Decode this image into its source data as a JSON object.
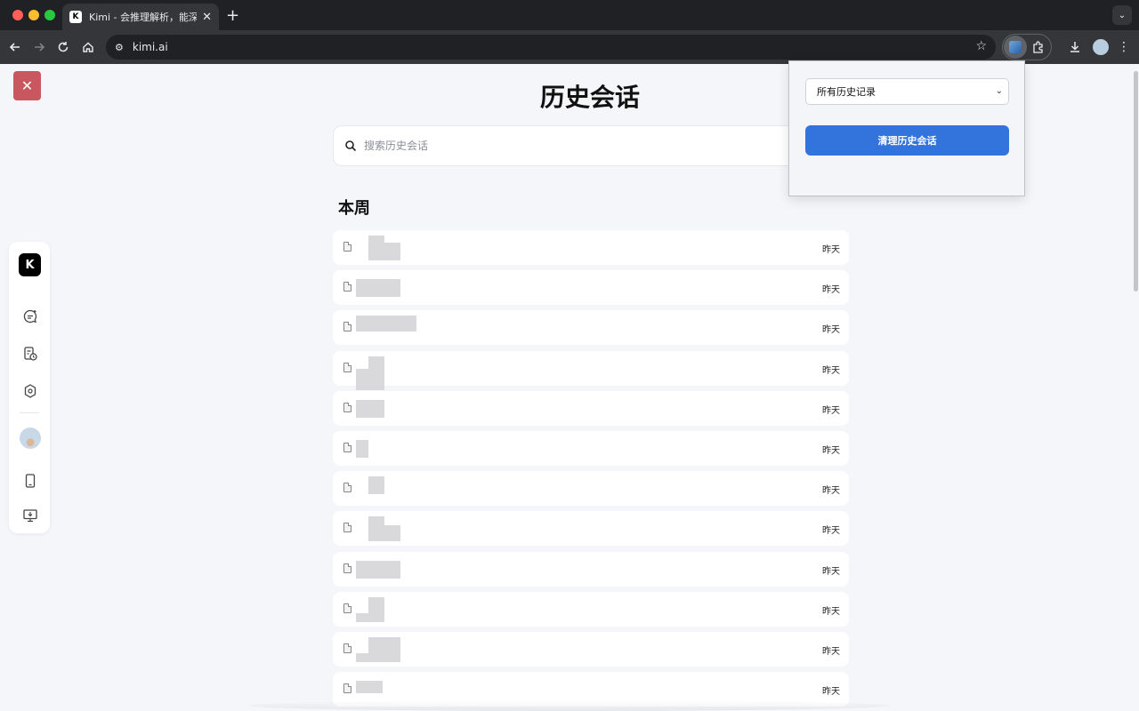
{
  "browser": {
    "tab_title": "Kimi - 会推理解析，能深度思考",
    "tab_favicon_text": "K",
    "url": "kimi.ai"
  },
  "page": {
    "title": "历史会话",
    "search_placeholder": "搜索历史会话",
    "section_heading": "本周",
    "rows": [
      {
        "time": "昨天"
      },
      {
        "time": "昨天"
      },
      {
        "time": "昨天"
      },
      {
        "time": "昨天"
      },
      {
        "time": "昨天"
      },
      {
        "time": "昨天"
      },
      {
        "time": "昨天"
      },
      {
        "time": "昨天"
      },
      {
        "time": "昨天"
      },
      {
        "time": "昨天"
      },
      {
        "time": "昨天"
      },
      {
        "time": "昨天"
      }
    ]
  },
  "sidebar": {
    "logo_text": "K",
    "icons": [
      "new-chat-icon",
      "history-icon",
      "explore-icon",
      "avatar",
      "mobile-icon",
      "desktop-download-icon"
    ]
  },
  "popup": {
    "select_value": "所有历史记录",
    "button_label": "清理历史会话"
  },
  "colors": {
    "close_button": "#c8575f",
    "popup_button": "#3273dc",
    "page_background": "#f4f6fa"
  }
}
